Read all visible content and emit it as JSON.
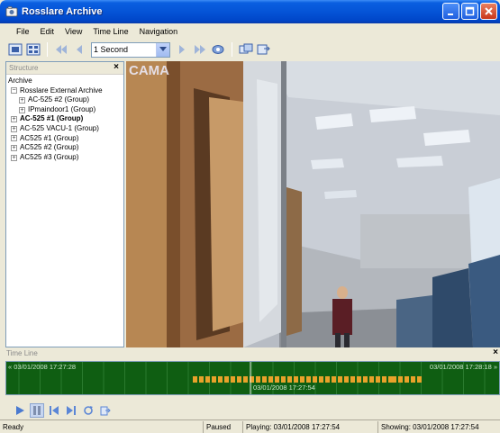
{
  "window": {
    "title": "Rosslare Archive",
    "icon": "app-icon"
  },
  "menu": [
    "File",
    "Edit",
    "View",
    "Time Line",
    "Navigation"
  ],
  "toolbar": {
    "speed_value": "1 Second",
    "icons": [
      "layout-single-icon",
      "layout-multi-icon",
      "skip-back-icon",
      "step-back-icon",
      "step-forward-icon",
      "skip-forward-icon",
      "camera-icon",
      "snapshot-icon",
      "export-icon"
    ]
  },
  "structure": {
    "title": "Structure",
    "tree": [
      {
        "label": "Archive",
        "level": 0,
        "expander": "",
        "bold": false
      },
      {
        "label": "Rosslare External Archive",
        "level": 1,
        "expander": "−",
        "bold": false
      },
      {
        "label": "AC-525 #2 (Group)",
        "level": 2,
        "expander": "+",
        "bold": false
      },
      {
        "label": "IPmaindoor1 (Group)",
        "level": 2,
        "expander": "+",
        "bold": false
      },
      {
        "label": "AC-525 #1 (Group)",
        "level": 1,
        "expander": "+",
        "bold": true
      },
      {
        "label": "AC-525 VACU-1 (Group)",
        "level": 1,
        "expander": "+",
        "bold": false
      },
      {
        "label": "AC525 #1 (Group)",
        "level": 1,
        "expander": "+",
        "bold": false
      },
      {
        "label": "AC525 #2 (Group)",
        "level": 1,
        "expander": "+",
        "bold": false
      },
      {
        "label": "AC525 #3 (Group)",
        "level": 1,
        "expander": "+",
        "bold": false
      }
    ]
  },
  "video": {
    "camera_label": "CAMA"
  },
  "timeline": {
    "title": "Time Line",
    "start_time": "« 03/01/2008 17:27:28",
    "end_time": "03/01/2008 17:28:18 »",
    "cursor_time": "03/01/2008 17:27:54",
    "cursor_position": 0.495,
    "track_color": "#0f5e12",
    "segment_color": "#e8a22a"
  },
  "controls": [
    "play-icon",
    "pause-icon",
    "previous-icon",
    "next-icon",
    "refresh-icon",
    "export-clip-icon"
  ],
  "status": {
    "ready": "Ready",
    "state": "Paused",
    "playing": "Playing: 03/01/2008 17:27:54",
    "showing": "Showing: 03/01/2008 17:27:54"
  }
}
